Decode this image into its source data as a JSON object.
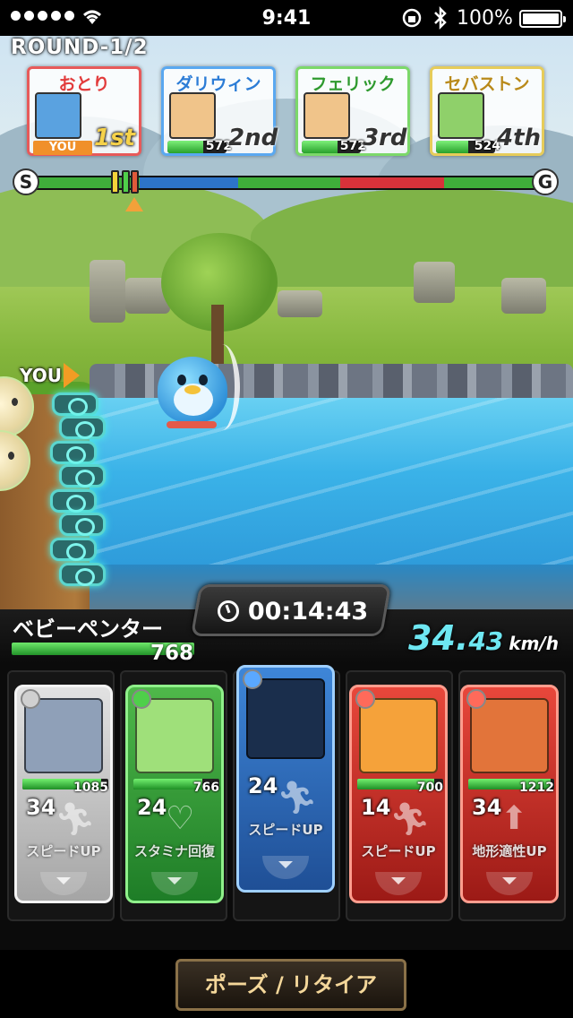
{
  "status_bar": {
    "time": "9:41",
    "battery_percent": "100%",
    "signal_dots": 5
  },
  "round": {
    "label": "ROUND-1/2"
  },
  "racers": [
    {
      "name": "おとり",
      "tag": "YOU",
      "rank": "1st",
      "name_color": "#e23b3b",
      "border": "#e75a5a",
      "portrait_color": "#5aa2e0"
    },
    {
      "name": "ダリウィン",
      "hp": "572",
      "rank": "2nd",
      "name_color": "#2b7cd6",
      "border": "#5aa8f0",
      "portrait_color": "#f0c48a",
      "hp_fraction": 0.6
    },
    {
      "name": "フェリック",
      "hp": "572",
      "rank": "3rd",
      "name_color": "#2e9a2e",
      "border": "#7cd86a",
      "portrait_color": "#f0c48a",
      "hp_fraction": 0.6
    },
    {
      "name": "セバストン",
      "hp": "524",
      "rank": "4th",
      "name_color": "#b98a1a",
      "border": "#e6cc5a",
      "portrait_color": "#8fd06a",
      "hp_fraction": 0.55
    }
  ],
  "track": {
    "start_label": "S",
    "goal_label": "G",
    "segments": [
      {
        "color": "#3fae3a"
      },
      {
        "color": "#2d74c9"
      },
      {
        "color": "#3fae3a"
      },
      {
        "color": "#d8323a"
      },
      {
        "color": "#3fae3a"
      }
    ],
    "player_progress": 0.2
  },
  "scene": {
    "you_marker": "YOU"
  },
  "hud": {
    "timer": "00:14:43",
    "character_name": "ベビーペンター",
    "character_hp": "768",
    "character_hp_fraction": 1.0,
    "speed_main": "34.",
    "speed_decimal": "43",
    "speed_unit": "km/h"
  },
  "cards": [
    {
      "type": "grey",
      "hp": "1085",
      "cost": "34",
      "skill": "スピードUP",
      "skill_icon": "running-icon",
      "art_color": "#8fa0b8",
      "orb_color": "#d0d0d0"
    },
    {
      "type": "green",
      "hp": "766",
      "cost": "24",
      "skill": "スタミナ回復",
      "skill_icon": "heart-icon",
      "art_color": "#9fe07a",
      "orb_color": "#4fcf4a"
    },
    {
      "type": "blue",
      "hp": "",
      "cost": "24",
      "skill": "スピードUP",
      "skill_icon": "running-icon",
      "art_color": "#1a2e4c",
      "orb_color": "#5aa8ff"
    },
    {
      "type": "red",
      "hp": "700",
      "cost": "14",
      "skill": "スピードUP",
      "skill_icon": "running-icon",
      "art_color": "#f5a23a",
      "orb_color": "#ff6a5a"
    },
    {
      "type": "red",
      "hp": "1212",
      "cost": "34",
      "skill": "地形適性UP",
      "skill_icon": "terrain-up-icon",
      "art_color": "#e2743a",
      "orb_color": "#ff6a5a"
    }
  ],
  "buttons": {
    "pause_retire": "ポーズ / リタイア"
  }
}
